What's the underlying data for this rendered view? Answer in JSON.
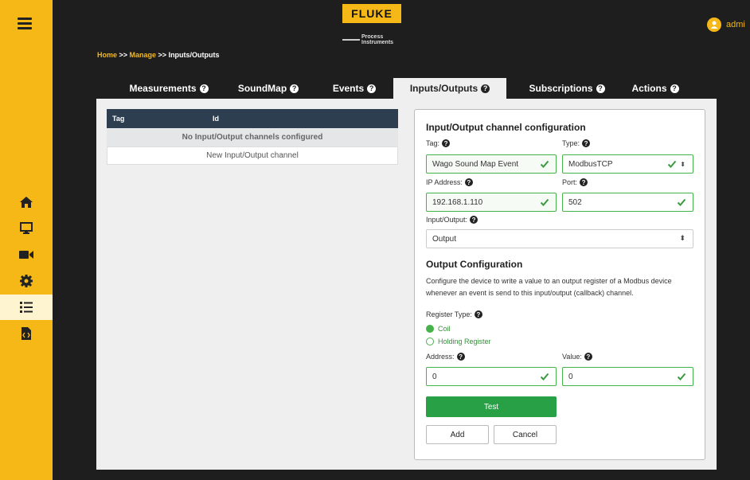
{
  "brand": {
    "name": "FLUKE",
    "sub1": "Process",
    "sub2": "Instruments"
  },
  "user": {
    "name": "admi"
  },
  "breadcrumb": {
    "home": "Home",
    "sep1": " >> ",
    "manage": "Manage",
    "sep2": " >> ",
    "current": "Inputs/Outputs"
  },
  "tabs": [
    {
      "label": "Measurements"
    },
    {
      "label": "SoundMap"
    },
    {
      "label": "Events"
    },
    {
      "label": "Inputs/Outputs"
    },
    {
      "label": "Subscriptions"
    },
    {
      "label": "Actions"
    }
  ],
  "help_glyph": "?",
  "table": {
    "headers": [
      "Tag",
      "Id"
    ],
    "empty_message": "No Input/Output channels configured",
    "new_row": "New Input/Output channel"
  },
  "form": {
    "title": "Input/Output channel configuration",
    "tag_label": "Tag:",
    "tag_value": "Wago Sound Map Event",
    "type_label": "Type:",
    "type_value": "ModbusTCP",
    "ip_label": "IP Address:",
    "ip_value": "192.168.1.110",
    "port_label": "Port:",
    "port_value": "502",
    "io_label": "Input/Output:",
    "io_value": "Output",
    "output_title": "Output Configuration",
    "desc_line1": "Configure the device to write a value to an output register of a Modbus device",
    "desc_line2": "whenever an event is send to this input/output (callback) channel.",
    "register_label": "Register Type:",
    "register_options": [
      "Coil",
      "Holding Register"
    ],
    "register_selected": "Coil",
    "address_label": "Address:",
    "address_value": "0",
    "value_label": "Value:",
    "value_value": "0",
    "test_label": "Test",
    "add_label": "Add",
    "cancel_label": "Cancel"
  },
  "colors": {
    "accent": "#f6b817",
    "success": "#27a046",
    "header": "#2c3e50"
  }
}
